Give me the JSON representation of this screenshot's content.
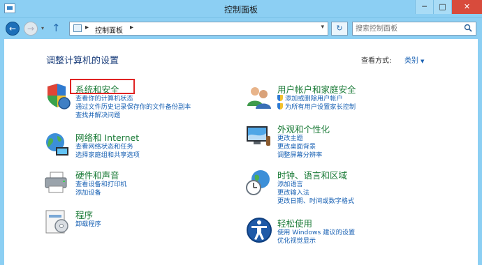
{
  "window": {
    "title": "控制面板",
    "buttons": [
      "─",
      "□",
      "✕"
    ]
  },
  "nav": {
    "back_glyph": "←",
    "forward_glyph": "→",
    "dropdown_glyph": "▾",
    "up_glyph": "↑"
  },
  "address": {
    "separator": "▸",
    "crumb": "控制面板",
    "crumb_sep": "▸",
    "dropdown_glyph": "▾",
    "refresh_glyph": "↻"
  },
  "search": {
    "placeholder": "搜索控制面板"
  },
  "page": {
    "title": "调整计算机的设置",
    "view_by_label": "查看方式:",
    "view_by_value": "类别",
    "view_by_caret": "▼"
  },
  "categories": {
    "system_security": {
      "title": "系统和安全",
      "links": [
        "查看你的计算机状态",
        "通过文件历史记录保存你的文件备份副本",
        "查找并解决问题"
      ]
    },
    "network": {
      "title": "网络和 Internet",
      "links": [
        "查看网络状态和任务",
        "选择家庭组和共享选项"
      ]
    },
    "hardware": {
      "title": "硬件和声音",
      "links": [
        "查看设备和打印机",
        "添加设备"
      ]
    },
    "programs": {
      "title": "程序",
      "links": [
        "卸载程序"
      ]
    },
    "user_accounts": {
      "title": "用户帐户和家庭安全",
      "links": [
        "添加或删除用户帐户",
        "为所有用户设置家长控制"
      ]
    },
    "appearance": {
      "title": "外观和个性化",
      "links": [
        "更改主题",
        "更改桌面背景",
        "调整屏幕分辨率"
      ]
    },
    "clock": {
      "title": "时钟、语言和区域",
      "links": [
        "添加语言",
        "更改输入法",
        "更改日期、时间或数字格式"
      ]
    },
    "ease": {
      "title": "轻松使用",
      "links": [
        "使用 Windows 建议的设置",
        "优化视觉显示"
      ]
    }
  },
  "colors": {
    "chrome": "#8ccff3",
    "category_title": "#197a36",
    "link": "#1a62b4",
    "highlight": "#e02424"
  }
}
